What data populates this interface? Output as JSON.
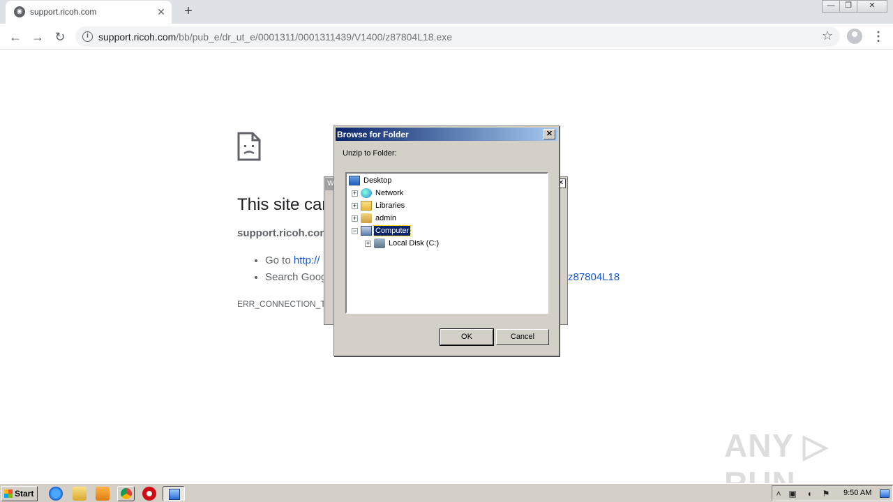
{
  "browser": {
    "tab_title": "support.ricoh.com",
    "tab_close": "✕",
    "new_tab": "+",
    "url_host": "support.ricoh.com",
    "url_path": "/bb/pub_e/dr_ut_e/0001311/0001311439/V1400/z87804L18.exe",
    "window_min": "—",
    "window_restore": "❐",
    "window_close": "✕"
  },
  "error_page": {
    "title": "This site car",
    "host": "support.ricoh.com",
    "suggestions": [
      {
        "prefix": "Go to ",
        "link": "http://"
      },
      {
        "text": "Search Goog"
      }
    ],
    "suggestion_tail": "z87804L18",
    "error_code": "ERR_CONNECTION_TIM"
  },
  "background_dialog": {
    "title_fragment": "W",
    "close": "✕"
  },
  "dialog": {
    "title": "Browse for Folder",
    "close": "✕",
    "prompt": "Unzip to Folder:",
    "tree": [
      {
        "label": "Desktop",
        "icon": "desktop-icon",
        "expander": "",
        "selected": false
      },
      {
        "label": "Network",
        "icon": "network-icon",
        "expander": "+",
        "selected": false
      },
      {
        "label": "Libraries",
        "icon": "libraries-icon",
        "expander": "+",
        "selected": false
      },
      {
        "label": "admin",
        "icon": "user-folder-icon",
        "expander": "+",
        "selected": false
      },
      {
        "label": "Computer",
        "icon": "computer-icon",
        "expander": "−",
        "selected": true
      },
      {
        "label": "Local Disk (C:)",
        "icon": "local-disk-icon",
        "expander": "+",
        "selected": false
      }
    ],
    "ok_label": "OK",
    "cancel_label": "Cancel",
    "colors": {
      "titlebar_start": "#0a246a",
      "titlebar_end": "#a6caf0",
      "selection": "#0a246a"
    }
  },
  "watermark": "ANY ▷ RUN",
  "taskbar": {
    "start_label": "Start",
    "clock": "9:50 AM",
    "tray_icons": [
      "chevron-up-icon",
      "network-tray-icon",
      "volume-icon",
      "flag-icon"
    ]
  }
}
